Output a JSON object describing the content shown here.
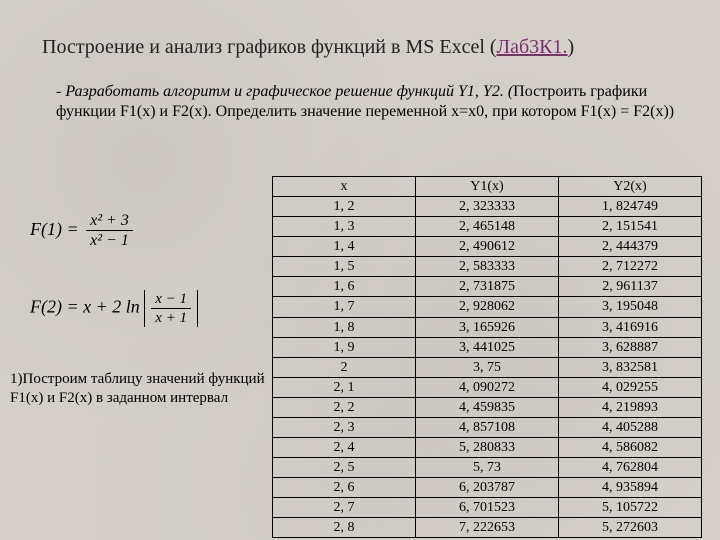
{
  "title": {
    "prefix": "Построение и анализ графиков функций в MS Excel (",
    "link": "Лаб3К1.",
    "suffix": ")"
  },
  "task": {
    "italic": "- Разработать алгоритм и  графическое решение функций Y1, Y2. (",
    "rest": "Построить  графики функции F1(x) и  F2(x). Определить  значение переменной х=х0, при котором  F1(x) =  F2(x))"
  },
  "formulae": {
    "f1_label": "F(1) = ",
    "f1_num": "x² + 3",
    "f1_den": "x² − 1",
    "f2_label": "F(2) = x + 2 ln",
    "f2_num": "x − 1",
    "f2_den": "x + 1"
  },
  "step": "1)Построим таблицу  значений функций F1(x) и F2(x) в заданном интервал",
  "table": {
    "headers": [
      "x",
      "Y1(x)",
      "Y2(x)"
    ],
    "rows": [
      [
        "1, 2",
        "2, 323333",
        "1, 824749"
      ],
      [
        "1, 3",
        "2, 465148",
        "2, 151541"
      ],
      [
        "1, 4",
        "2, 490612",
        "2, 444379"
      ],
      [
        "1, 5",
        "2, 583333",
        "2, 712272"
      ],
      [
        "1, 6",
        "2, 731875",
        "2, 961137"
      ],
      [
        "1, 7",
        "2, 928062",
        "3, 195048"
      ],
      [
        "1, 8",
        "3, 165926",
        "3, 416916"
      ],
      [
        "1, 9",
        "3, 441025",
        "3, 628887"
      ],
      [
        "2",
        "3, 75",
        "3, 832581"
      ],
      [
        "2, 1",
        "4, 090272",
        "4, 029255"
      ],
      [
        "2, 2",
        "4, 459835",
        "4, 219893"
      ],
      [
        "2, 3",
        "4, 857108",
        "4, 405288"
      ],
      [
        "2, 4",
        "5, 280833",
        "4, 586082"
      ],
      [
        "2, 5",
        "5, 73",
        "4, 762804"
      ],
      [
        "2, 6",
        "6, 203787",
        "4, 935894"
      ],
      [
        "2, 7",
        "6, 701523",
        "5, 105722"
      ],
      [
        "2, 8",
        "7, 222653",
        "5, 272603"
      ]
    ]
  }
}
